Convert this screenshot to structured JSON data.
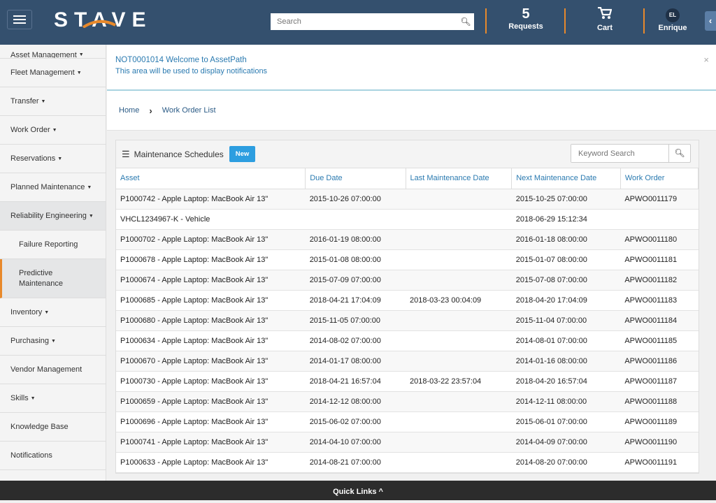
{
  "header": {
    "logo": "STAVE",
    "search_placeholder": "Search",
    "requests_count": "5",
    "requests_label": "Requests",
    "cart_label": "Cart",
    "user_initials": "EL",
    "user_name": "Enrique",
    "accent": "#e8892b"
  },
  "sidebar": {
    "items": [
      {
        "label": "Asset Management",
        "caret": true
      },
      {
        "label": "Fleet Management",
        "caret": true
      },
      {
        "label": "Transfer",
        "caret": true
      },
      {
        "label": "Work Order",
        "caret": true
      },
      {
        "label": "Reservations",
        "caret": true
      },
      {
        "label": "Planned Maintenance",
        "caret": true
      },
      {
        "label": "Reliability Engineering",
        "caret": true,
        "active": true
      },
      {
        "label": "Failure Reporting",
        "sub": true
      },
      {
        "label": "Predictive Maintenance",
        "sub": true,
        "selected": true
      },
      {
        "label": "Inventory",
        "caret": true
      },
      {
        "label": "Purchasing",
        "caret": true
      },
      {
        "label": "Vendor Management"
      },
      {
        "label": "Skills",
        "caret": true
      },
      {
        "label": "Knowledge Base"
      },
      {
        "label": "Notifications"
      }
    ]
  },
  "notification": {
    "title": "NOT0001014 Welcome to AssetPath",
    "body": "This area will be used to display notifications"
  },
  "breadcrumb": {
    "home": "Home",
    "current": "Work Order List"
  },
  "panel": {
    "title": "Maintenance Schedules",
    "new_label": "New",
    "keyword_placeholder": "Keyword Search"
  },
  "table": {
    "columns": [
      "Asset",
      "Due Date",
      "Last Maintenance Date",
      "Next Maintenance Date",
      "Work Order"
    ],
    "rows": [
      [
        "P1000742 - Apple Laptop: MacBook Air 13\"",
        "2015-10-26 07:00:00",
        "",
        "2015-10-25 07:00:00",
        "APWO0011179"
      ],
      [
        "VHCL1234967-K - Vehicle",
        "",
        "",
        "2018-06-29 15:12:34",
        ""
      ],
      [
        "P1000702 - Apple Laptop: MacBook Air 13\"",
        "2016-01-19 08:00:00",
        "",
        "2016-01-18 08:00:00",
        "APWO0011180"
      ],
      [
        "P1000678 - Apple Laptop: MacBook Air 13\"",
        "2015-01-08 08:00:00",
        "",
        "2015-01-07 08:00:00",
        "APWO0011181"
      ],
      [
        "P1000674 - Apple Laptop: MacBook Air 13\"",
        "2015-07-09 07:00:00",
        "",
        "2015-07-08 07:00:00",
        "APWO0011182"
      ],
      [
        "P1000685 - Apple Laptop: MacBook Air 13\"",
        "2018-04-21 17:04:09",
        "2018-03-23 00:04:09",
        "2018-04-20 17:04:09",
        "APWO0011183"
      ],
      [
        "P1000680 - Apple Laptop: MacBook Air 13\"",
        "2015-11-05 07:00:00",
        "",
        "2015-11-04 07:00:00",
        "APWO0011184"
      ],
      [
        "P1000634 - Apple Laptop: MacBook Air 13\"",
        "2014-08-02 07:00:00",
        "",
        "2014-08-01 07:00:00",
        "APWO0011185"
      ],
      [
        "P1000670 - Apple Laptop: MacBook Air 13\"",
        "2014-01-17 08:00:00",
        "",
        "2014-01-16 08:00:00",
        "APWO0011186"
      ],
      [
        "P1000730 - Apple Laptop: MacBook Air 13\"",
        "2018-04-21 16:57:04",
        "2018-03-22 23:57:04",
        "2018-04-20 16:57:04",
        "APWO0011187"
      ],
      [
        "P1000659 - Apple Laptop: MacBook Air 13\"",
        "2014-12-12 08:00:00",
        "",
        "2014-12-11 08:00:00",
        "APWO0011188"
      ],
      [
        "P1000696 - Apple Laptop: MacBook Air 13\"",
        "2015-06-02 07:00:00",
        "",
        "2015-06-01 07:00:00",
        "APWO0011189"
      ],
      [
        "P1000741 - Apple Laptop: MacBook Air 13\"",
        "2014-04-10 07:00:00",
        "",
        "2014-04-09 07:00:00",
        "APWO0011190"
      ],
      [
        "P1000633 - Apple Laptop: MacBook Air 13\"",
        "2014-08-21 07:00:00",
        "",
        "2014-08-20 07:00:00",
        "APWO0011191"
      ]
    ]
  },
  "footer": {
    "label": "Quick Links ^"
  }
}
